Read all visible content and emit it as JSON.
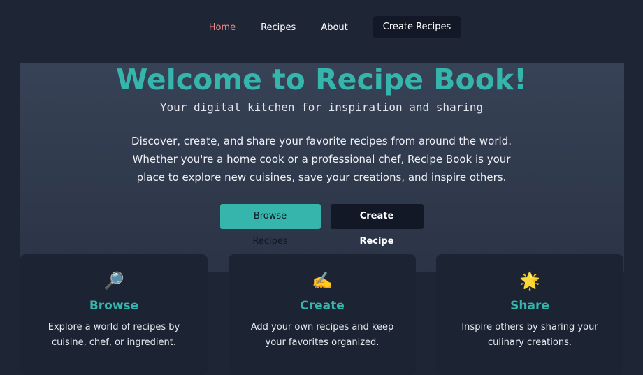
{
  "nav": {
    "home": "Home",
    "recipes": "Recipes",
    "about": "About",
    "create": "Create Recipes"
  },
  "hero": {
    "title": "Welcome to Recipe Book!",
    "subtitle": "Your digital kitchen for inspiration and sharing",
    "description_lines": [
      "Discover, create, and share your favorite recipes from around the world.",
      "Whether you're a home cook or a professional chef, Recipe Book is your",
      "place to explore new cuisines, save your creations, and inspire others."
    ],
    "browse_button": "Browse Recipes",
    "create_button": "Create Recipe"
  },
  "cards": [
    {
      "icon": "🔎",
      "title": "Browse",
      "text": "Explore a world of recipes by cuisine, chef, or ingredient."
    },
    {
      "icon": "✍️",
      "title": "Create",
      "text": "Add your own recipes and keep your favorites organized."
    },
    {
      "icon": "🌟",
      "title": "Share",
      "text": "Inspire others by sharing your culinary creations."
    }
  ],
  "colors": {
    "accent": "#35b5ac",
    "active_nav": "#f08a8a",
    "background": "#1e2636"
  }
}
